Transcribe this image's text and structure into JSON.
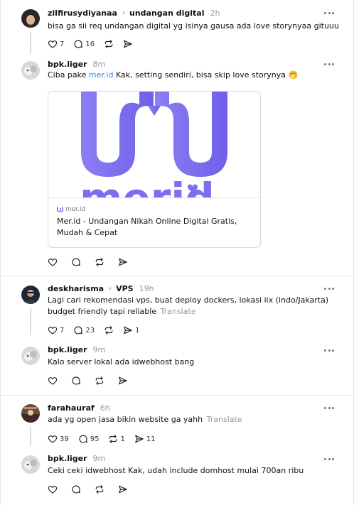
{
  "posts": [
    {
      "username": "zilfirusydiyanaa",
      "topic": "undangan digital",
      "time": "2h",
      "text": "bisa ga sii req undangan digital yg isinya gausa ada love storynyaa gituuu",
      "counts": {
        "like": "7",
        "comment": "16",
        "repost": "",
        "share": ""
      }
    },
    {
      "username": "bpk.liger",
      "time": "8m",
      "text_before": "Ciba pake ",
      "link": "mer.id",
      "text_after": " Kak, setting sendiri, bisa skip love storynya 🤭",
      "card": {
        "site": "mer.id",
        "title": "Mer.id - Undangan Nikah Online Digital Gratis, Mudah & Cepat",
        "logo_text": "merid"
      }
    },
    {
      "username": "deskharisma",
      "topic": "VPS",
      "time": "19h",
      "text": "Lagi cari rekomendasi vps, buat deploy dockers, lokasi iix (indo/Jakarta) budget friendly tapi reliable",
      "translate": "Translate",
      "counts": {
        "like": "7",
        "comment": "23",
        "repost": "",
        "share": "1"
      }
    },
    {
      "username": "bpk.liger",
      "time": "9m",
      "text": "Kalo server lokal ada idwebhost bang"
    },
    {
      "username": "farahauraf",
      "time": "6h",
      "text": "ada yg open jasa bikin website ga yahh",
      "translate": "Translate",
      "counts": {
        "like": "39",
        "comment": "95",
        "repost": "1",
        "share": "11"
      }
    },
    {
      "username": "bpk.liger",
      "time": "9m",
      "text": "Ceki ceki idwebhost Kak, udah include domhost mulai 700an ribu"
    }
  ],
  "colors": {
    "brand_purple": "#7b6ef0",
    "link_blue": "#3b82f6"
  }
}
